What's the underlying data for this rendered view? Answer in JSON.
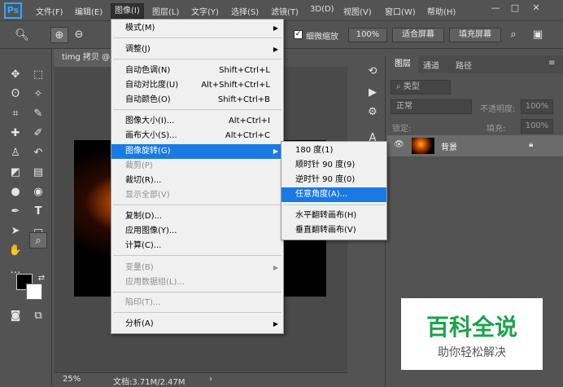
{
  "app": {
    "logo": "Ps"
  },
  "menubar": [
    "文件(F)",
    "编辑(E)",
    "图像(I)",
    "图层(L)",
    "文字(Y)",
    "选择(S)",
    "滤镜(T)",
    "3D(D)",
    "视图(V)",
    "窗口(W)",
    "帮助(H)"
  ],
  "window_controls": {
    "minimize": "—",
    "restore": "□",
    "close": "✕"
  },
  "options": {
    "zoom_all_windows": "细微缩放",
    "zoom_value": "100%",
    "fit_screen": "适合屏幕",
    "fill_screen": "填充屏幕"
  },
  "document": {
    "tab": "timg 拷贝 @",
    "zoom": "25%",
    "doc_size": "文档:3.71M/2.47M"
  },
  "image_menu": {
    "items": [
      {
        "label": "模式(M)",
        "shortcut": "",
        "submenu": true,
        "disabled": false
      },
      {
        "label": "调整(J)",
        "shortcut": "",
        "submenu": true,
        "disabled": false
      },
      {
        "label": "自动色调(N)",
        "shortcut": "Shift+Ctrl+L",
        "submenu": false,
        "disabled": false
      },
      {
        "label": "自动对比度(U)",
        "shortcut": "Alt+Shift+Ctrl+L",
        "submenu": false,
        "disabled": false
      },
      {
        "label": "自动颜色(O)",
        "shortcut": "Shift+Ctrl+B",
        "submenu": false,
        "disabled": false
      },
      {
        "label": "图像大小(I)...",
        "shortcut": "Alt+Ctrl+I",
        "submenu": false,
        "disabled": false
      },
      {
        "label": "画布大小(S)...",
        "shortcut": "Alt+Ctrl+C",
        "submenu": false,
        "disabled": false
      },
      {
        "label": "图像旋转(G)",
        "shortcut": "",
        "submenu": true,
        "disabled": false,
        "highlighted": true
      },
      {
        "label": "裁剪(P)",
        "shortcut": "",
        "submenu": false,
        "disabled": true
      },
      {
        "label": "裁切(R)...",
        "shortcut": "",
        "submenu": false,
        "disabled": false
      },
      {
        "label": "显示全部(V)",
        "shortcut": "",
        "submenu": false,
        "disabled": true
      },
      {
        "label": "复制(D)...",
        "shortcut": "",
        "submenu": false,
        "disabled": false
      },
      {
        "label": "应用图像(Y)...",
        "shortcut": "",
        "submenu": false,
        "disabled": false
      },
      {
        "label": "计算(C)...",
        "shortcut": "",
        "submenu": false,
        "disabled": false
      },
      {
        "label": "变量(B)",
        "shortcut": "",
        "submenu": true,
        "disabled": true
      },
      {
        "label": "应用数据组(L)...",
        "shortcut": "",
        "submenu": false,
        "disabled": true
      },
      {
        "label": "陷印(T)...",
        "shortcut": "",
        "submenu": false,
        "disabled": true
      },
      {
        "label": "分析(A)",
        "shortcut": "",
        "submenu": true,
        "disabled": false
      }
    ]
  },
  "rotate_submenu": {
    "items": [
      {
        "label": "180 度(1)",
        "highlighted": false
      },
      {
        "label": "顺时针 90 度(9)",
        "highlighted": false
      },
      {
        "label": "逆时针 90 度(0)",
        "highlighted": false
      },
      {
        "label": "任意角度(A)...",
        "highlighted": true
      },
      {
        "label": "水平翻转画布(H)",
        "highlighted": false
      },
      {
        "label": "垂直翻转画布(V)",
        "highlighted": false
      }
    ]
  },
  "layers_panel": {
    "tabs": [
      "图层",
      "通道",
      "路径"
    ],
    "filter_placeholder": "类型",
    "blend_mode": "正常",
    "opacity_label": "不透明度:",
    "opacity": "100%",
    "lock_label": "锁定:",
    "fill_label": "填充:",
    "fill": "100%",
    "layer_name": "背景"
  },
  "watermark": {
    "title": "百科全说",
    "subtitle": "助你轻松解决"
  },
  "colors": {
    "accent": "#1a7ae4",
    "ps_blue": "#31a8ff",
    "watermark_green": "#1aa34a"
  }
}
